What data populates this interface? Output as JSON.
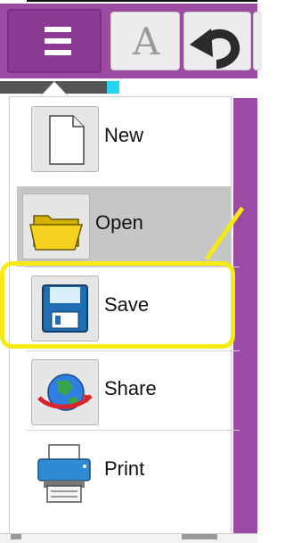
{
  "menu": {
    "items": [
      {
        "label": "New",
        "icon": "new-document-icon"
      },
      {
        "label": "Open",
        "icon": "folder-icon"
      },
      {
        "label": "Save",
        "icon": "floppy-disk-icon"
      },
      {
        "label": "Share",
        "icon": "globe-share-icon"
      },
      {
        "label": "Print",
        "icon": "printer-icon"
      }
    ],
    "selected": "Open"
  },
  "toolbar": {
    "text_tool_glyph": "A",
    "menu_icon": "hamburger-menu-icon",
    "undo_icon": "undo-icon"
  },
  "colors": {
    "toolbar_purple": "#9d4aa3",
    "highlight_yellow": "#f5ea11",
    "progress_cyan": "#23d6ee"
  }
}
